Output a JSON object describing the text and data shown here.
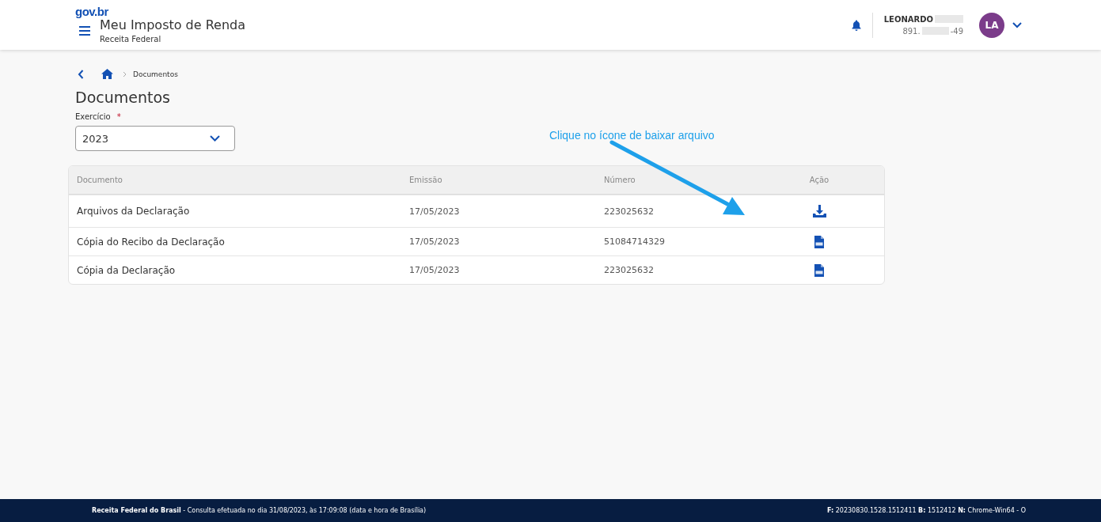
{
  "header": {
    "logo": "gov.br",
    "title": "Meu Imposto de Renda",
    "subtitle": "Receita Federal",
    "user": {
      "name": "LEONARDO",
      "id_start": "891.",
      "id_end": "-49",
      "initials": "LA"
    }
  },
  "breadcrumb": [
    "Documentos"
  ],
  "page_title": "Documentos",
  "exercise": {
    "label": "Exercício",
    "required_mark": "*",
    "value": "2023"
  },
  "annotation": {
    "text": "Clique no ícone de baixar arquivo"
  },
  "table": {
    "columns": [
      "Documento",
      "Emissão",
      "Número",
      "Ação"
    ],
    "rows": [
      {
        "document": "Arquivos da Declaração",
        "date": "17/05/2023",
        "number": "223025632",
        "kind": "download"
      },
      {
        "document": "Cópia do Recibo da Declaração",
        "date": "17/05/2023",
        "number": "51084714329",
        "kind": "pdf"
      },
      {
        "document": "Cópia da Declaração",
        "date": "17/05/2023",
        "number": "223025632",
        "kind": "pdf"
      }
    ]
  },
  "footer": {
    "left": "**Receita Federal do Brasil** - Consulta efetuada no dia 31/08/2023, às 17:09:08 (data e hora de Brasília)",
    "right": "**F:** 20230830.1528.1512411 **B:** 1512412 **N:** Chrome-Win64 - O"
  }
}
